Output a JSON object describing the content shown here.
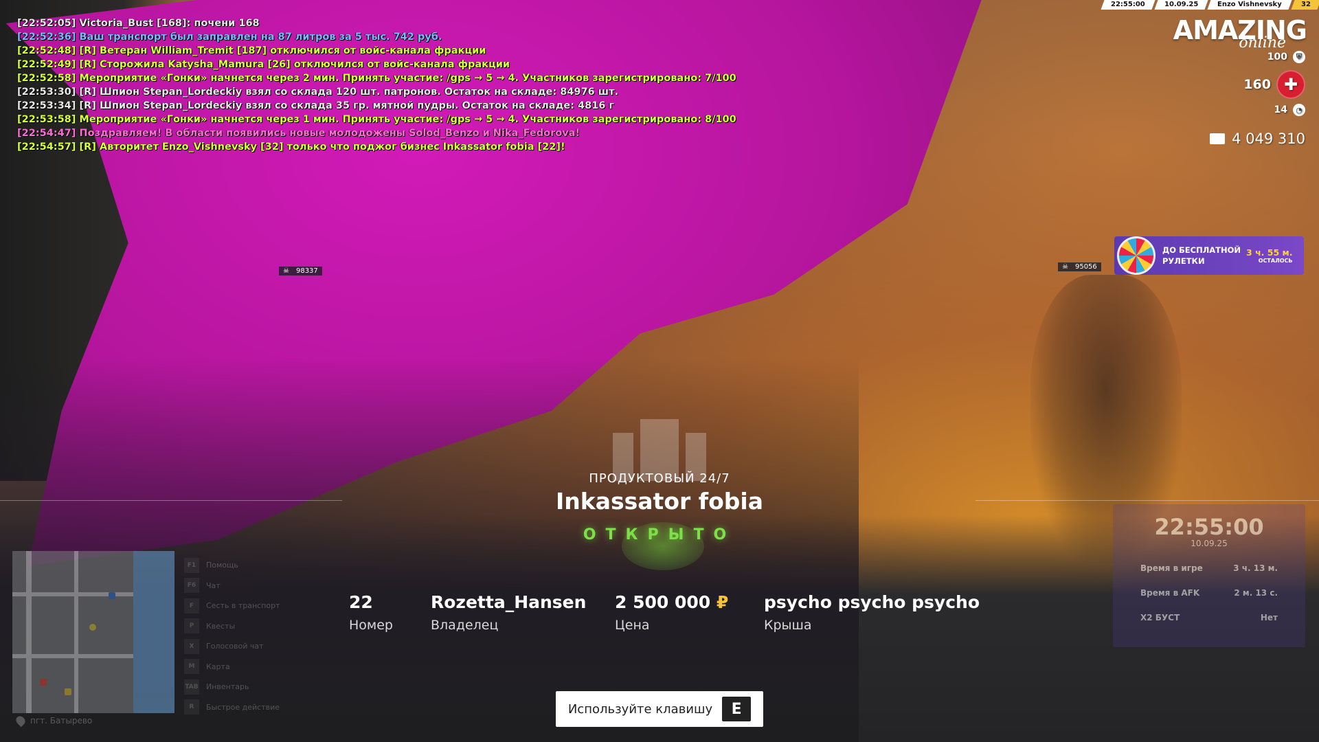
{
  "chat": [
    {
      "text": "[22:52:05] Victoria_Bust [168]: почени 168",
      "color": "white"
    },
    {
      "text": "[22:52:36] Ваш транспорт был заправлен на 87 литров за 5 тыс. 742 руб.",
      "color": "blue"
    },
    {
      "text": "[22:52:48] [R] Ветеран William_Tremit [187] отключился от войс-канала фракции",
      "color": "yellow"
    },
    {
      "text": "[22:52:49] [R] Сторожила Katysha_Mamura [26] отключился от войс-канала фракции",
      "color": "yellow"
    },
    {
      "text": "[22:52:58] Мероприятие «Гонки» начнется через 2 мин. Принять участие: /gps → 5 → 4. Участников зарегистрировано: 7/100",
      "color": "yellow"
    },
    {
      "text": "[22:53:30] [R] Шпион Stepan_Lordeckiy взял со склада 120 шт. патронов. Остаток на складе: 84976 шт.",
      "color": "white"
    },
    {
      "text": "[22:53:34] [R] Шпион Stepan_Lordeckiy взял со склада 35 гр. мятной пудры. Остаток на складе: 4816 г",
      "color": "white"
    },
    {
      "text": "[22:53:58] Мероприятие «Гонки» начнется через 1 мин. Принять участие: /gps → 5 → 4. Участников зарегистрировано: 8/100",
      "color": "yellow"
    },
    {
      "text": "[22:54:47] Поздравляем! В области появились новые молодожены Solod_Benzo и Nika_Fedorova!",
      "color": "pink"
    },
    {
      "text": "[22:54:57] [R] Авторитет Enzo_Vishnevsky [32] только что поджог бизнес Inkassator fobia [22]!",
      "color": "yellow"
    }
  ],
  "topbar": {
    "time": "22:55:00",
    "date": "10.09.25",
    "player": "Enzo Vishnevsky",
    "level": "32"
  },
  "logo": {
    "main": "AMAZING",
    "sub": "online"
  },
  "hud": {
    "armor": "100",
    "health": "160",
    "satiety": "14",
    "money": "4 049 310"
  },
  "roulette": {
    "label_line1": "ДО БЕСПЛАТНОЙ",
    "label_line2": "РУЛЕТКИ",
    "time": "3 ч. 55 м.",
    "remain": "ОСТАЛОСЬ"
  },
  "tags": {
    "left": "98337",
    "right": "95056"
  },
  "business": {
    "type": "ПРОДУКТОВЫЙ 24/7",
    "name": "Inkassator fobia",
    "status": "ОТКРЫТО",
    "number": "22",
    "number_label": "Номер",
    "owner": "Rozetta_Hansen",
    "owner_label": "Владелец",
    "price": "2 500 000",
    "currency": "₽",
    "price_label": "Цена",
    "roof": "psycho psycho psycho",
    "roof_label": "Крыша"
  },
  "hint": {
    "text": "Используйте клавишу",
    "key": "E"
  },
  "keys": [
    {
      "k": "F1",
      "label": "Помощь"
    },
    {
      "k": "F6",
      "label": "Чат"
    },
    {
      "k": "F",
      "label": "Сесть в транспорт"
    },
    {
      "k": "P",
      "label": "Квесты"
    },
    {
      "k": "X",
      "label": "Голосовой чат"
    },
    {
      "k": "M",
      "label": "Карта"
    },
    {
      "k": "TAB",
      "label": "Инвентарь"
    },
    {
      "k": "R",
      "label": "Быстрое действие"
    }
  ],
  "map_location": "пгт. Батырево",
  "clock": {
    "time": "22:55:00",
    "date": "10.09.25",
    "rows": [
      {
        "label": "Время в игре",
        "value": "3 ч. 13 м."
      },
      {
        "label": "Время в AFK",
        "value": "2 м. 13 с."
      },
      {
        "label": "X2 БУСТ",
        "value": "Нет"
      }
    ]
  },
  "colors": {
    "status_green": "#7de04a",
    "accent_gold": "#f4c43a",
    "hp_red": "#d81f2f"
  }
}
